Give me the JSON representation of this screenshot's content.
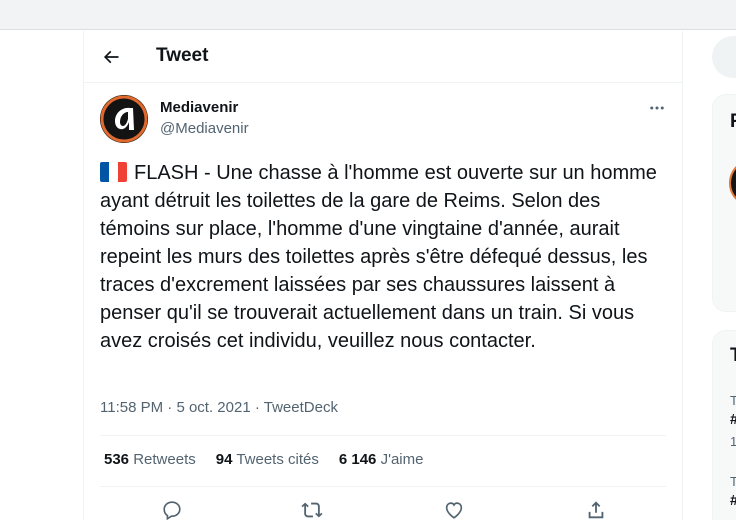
{
  "header": {
    "title": "Tweet"
  },
  "author": {
    "name": "Mediavenir",
    "handle": "@Mediavenir"
  },
  "tweet": {
    "flag_colors": [
      "#0055a4",
      "#ffffff",
      "#ef4135"
    ],
    "text": "FLASH - Une chasse à l'homme est ouverte sur un homme ayant détruit les toilettes de la gare de Reims. Selon des témoins sur place, l'homme d'une vingtaine d'année, aurait repeint les murs des toilettes après s'être défequé dessus, les traces d'excrement laissées par ses chaussures laissent à penser qu'il se trouverait actuellement dans un train. Si vous avez croisés cet individu, veuillez nous contacter.",
    "time": "11:58 PM",
    "date": "5 oct. 2021",
    "source": "TweetDeck",
    "separator": "·"
  },
  "stats": [
    {
      "count": "536",
      "label": "Retweets"
    },
    {
      "count": "94",
      "label": "Tweets cités"
    },
    {
      "count": "6 146",
      "label": "J'aime"
    }
  ],
  "actions": [
    "reply-icon",
    "retweet-icon",
    "like-icon",
    "share-icon"
  ],
  "sidebar": {
    "card1_title_fragment": "F",
    "card2_title_fragment": "T",
    "trends": [
      {
        "context": "T",
        "name": "#",
        "count": "1"
      },
      {
        "context": "T",
        "name": "#"
      }
    ]
  },
  "colors": {
    "accent": "#1d9bf0",
    "text": "#0f1419",
    "muted": "#536471",
    "border": "#eff3f4"
  }
}
